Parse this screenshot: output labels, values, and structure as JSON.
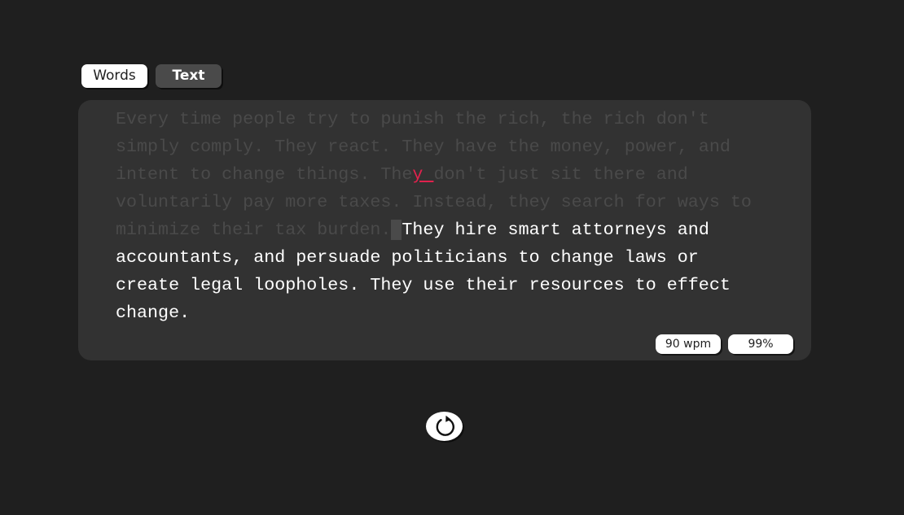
{
  "mode_tabs": {
    "words_label": "Words",
    "text_label": "Text",
    "active": "Words"
  },
  "passage": {
    "typed_before_error": "Every time people try to punish the rich, the rich don't simply comply. They react. They have the money, power, and intent to change things. The",
    "error_chars": "y ",
    "typed_after_error": "don't just sit there and voluntarily pay more taxes. Instead, they search for ways to minimize their tax burden.",
    "cursor_char": " ",
    "remaining": "They hire smart attorneys and accountants, and persuade politicians to change laws or create legal loopholes. They use their resources to effect change."
  },
  "stats": {
    "wpm": "90 wpm",
    "accuracy": "99%"
  },
  "restart": {
    "icon": "restart-icon"
  },
  "colors": {
    "background": "#1f1f1f",
    "panel": "#323232",
    "typed_text": "#4a4a4a",
    "remaining_text": "#ffffff",
    "error_text": "#e0224d"
  }
}
